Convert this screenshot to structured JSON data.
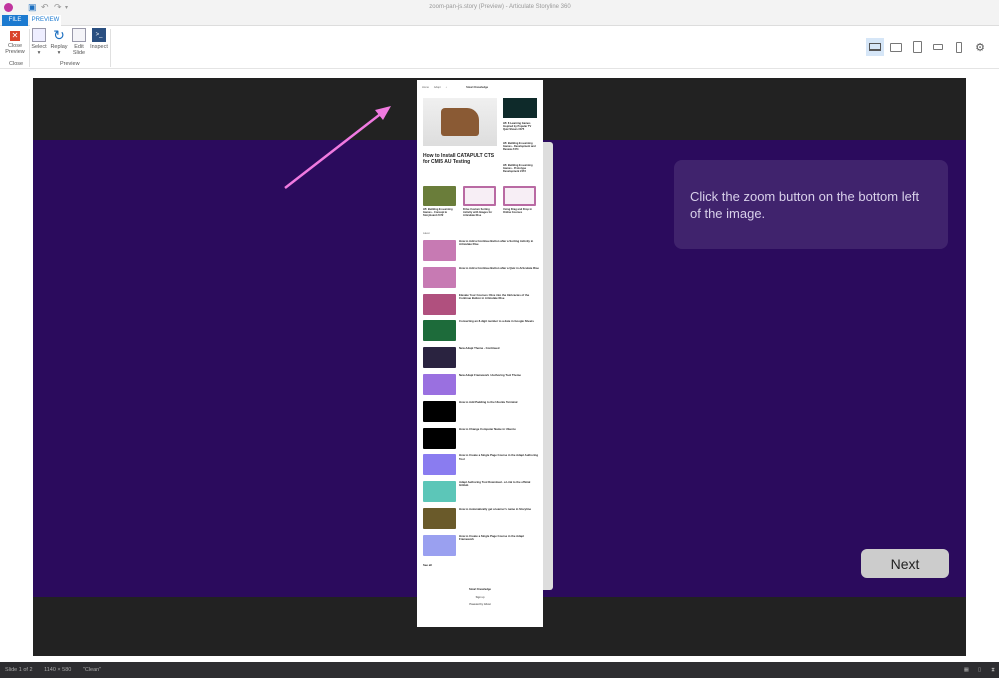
{
  "window": {
    "title": "zoom-pan-js.story (Preview) - Articulate Storyline 360"
  },
  "tabs": [
    {
      "label": "FILE"
    },
    {
      "label": "PREVIEW"
    }
  ],
  "ribbon": {
    "close_group": {
      "label": "Close",
      "buttons": [
        {
          "label": "Close Preview"
        }
      ]
    },
    "preview_group": {
      "label": "Preview",
      "buttons": [
        {
          "label": "Select"
        },
        {
          "label": "Replay"
        },
        {
          "label": "Edit Slide"
        },
        {
          "label": "Inspect"
        }
      ]
    }
  },
  "devices": [
    "laptop",
    "tablet-landscape",
    "tablet-portrait",
    "phone-landscape",
    "phone-portrait",
    "settings"
  ],
  "slide": {
    "instruction": "Click the zoom button on the bottom left of the image.",
    "next_label": "Next",
    "colors": {
      "band": "#2b0b5d",
      "arrow": "#f07ae0",
      "stage": "#222222"
    },
    "website": {
      "nav": [
        "Home",
        "Adapt",
        "Storyline"
      ],
      "logo": "Smart Knowledge",
      "hero_title": "How to Install CATAPULT CTS for CMI5 AU Testing",
      "side": [
        "H5: 8 Learning Games Inspired by Popular TV Quiz Shows #475",
        "H5: Building E-Learning Games - Development and Review #474",
        "H5: Building E-Learning Games - Prototype Development #473"
      ],
      "cards": [
        "H5: Building E-Learning Games - Concept & Storyboard #472",
        "Drive Custom Sorting Activity with Images for Articulate Rise",
        "Using Drag and Drop in Online Courses"
      ],
      "latest_label": "Latest",
      "list": [
        "How to Add a Continue Button after a Sorting Activity in Articulate Rise",
        "How to Add a Continue Button after a Quiz in Articulate Rise",
        "Elevate Your Courses: Dive into the Intricacies of the Continue Button in Articulate Rise",
        "Converting an 8-digit number to a date in Google Sheets",
        "New Adapt Theme - Continued",
        "New Adapt Framework / Authoring Tool Theme",
        "How to Add Padding to the Ubuntu Terminal",
        "How to Change Computer Name in Ubuntu",
        "How to Create a Single Page Course in the Adapt Authoring Tool",
        "Adapt Authoring Tool Download - a Link to the official GitHub",
        "How to Automatically get a learner's name in Storyline",
        "How to Create a Single Page Course in the Adapt Framework"
      ],
      "see_all": "See all",
      "footer": [
        "Smart Knowledge",
        "Sign up",
        "Powered by Ghost"
      ]
    }
  },
  "status": {
    "slide": "Slide 1 of 2",
    "size": "1140 × 580",
    "theme": "\"Clean\""
  }
}
